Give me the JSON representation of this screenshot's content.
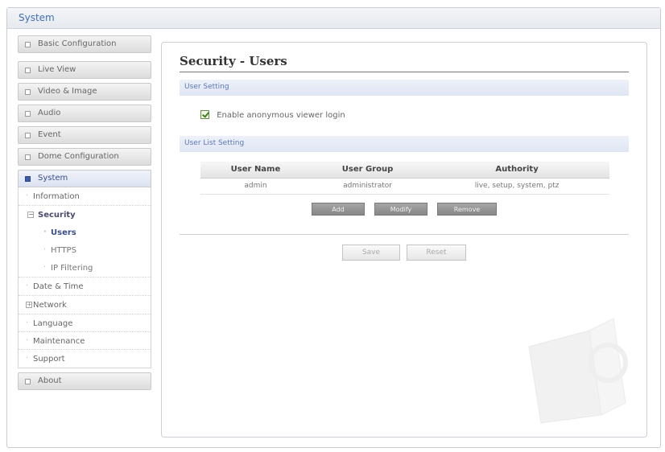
{
  "topbar": {
    "title": "System"
  },
  "sidebar": {
    "top_items": [
      {
        "label": "Basic Configuration"
      },
      {
        "label": "Live View"
      },
      {
        "label": "Video & Image"
      },
      {
        "label": "Audio"
      },
      {
        "label": "Event"
      },
      {
        "label": "Dome Configuration"
      }
    ],
    "active_item": {
      "label": "System"
    },
    "system_menu": {
      "information": "Information",
      "security": "Security",
      "security_children": [
        "Users",
        "HTTPS",
        "IP Filtering"
      ],
      "date_time": "Date & Time",
      "network": "Network",
      "language": "Language",
      "maintenance": "Maintenance",
      "support": "Support"
    },
    "bottom_item": {
      "label": "About"
    }
  },
  "content": {
    "title": "Security - Users",
    "user_setting_header": "User Setting",
    "anonymous_login_label": "Enable anonymous viewer login",
    "anonymous_login_checked": true,
    "user_list_header": "User List Setting",
    "table": {
      "headers": [
        "User Name",
        "User Group",
        "Authority"
      ],
      "rows": [
        [
          "admin",
          "administrator",
          "live, setup, system, ptz"
        ]
      ]
    },
    "buttons": {
      "add": "Add",
      "modify": "Modify",
      "remove": "Remove",
      "save": "Save",
      "reset": "Reset"
    }
  },
  "colors": {
    "accent": "#3f6fb6",
    "section_bg": "#e4e9f5",
    "active_nav": "#3b5aa8"
  }
}
